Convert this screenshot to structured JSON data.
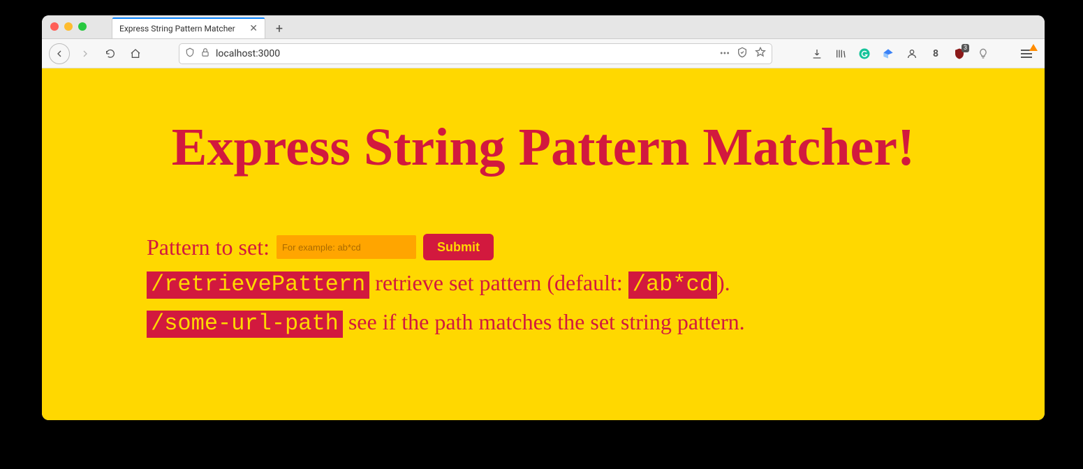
{
  "browser": {
    "tab_title": "Express String Pattern Matcher",
    "url": "localhost:3000",
    "shield_badge": "3",
    "ext_number": "8"
  },
  "page": {
    "heading": "Express String Pattern Matcher!",
    "form": {
      "label": "Pattern to set:",
      "placeholder": "For example: ab*cd",
      "submit": "Submit"
    },
    "line1": {
      "code": "/retrievePattern",
      "text_before_code2": " retrieve set pattern (default: ",
      "code2": "/ab*cd",
      "text_after": ")."
    },
    "line2": {
      "code": "/some-url-path",
      "text": " see if the path matches the set string pattern."
    }
  }
}
